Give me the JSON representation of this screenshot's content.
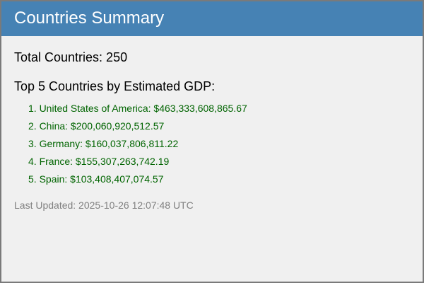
{
  "header": {
    "title": "Countries Summary"
  },
  "summary": {
    "total_label": "Total Countries: 250",
    "top_heading": "Top 5 Countries by Estimated GDP:",
    "countries": [
      {
        "text": "1. United States of America: $463,333,608,865.67"
      },
      {
        "text": "2. China: $200,060,920,512.57"
      },
      {
        "text": "3. Germany: $160,037,806,811.22"
      },
      {
        "text": "4. France: $155,307,263,742.19"
      },
      {
        "text": "5. Spain: $103,408,407,074.57"
      }
    ],
    "last_updated": "Last Updated: 2025-10-26 12:07:48 UTC"
  },
  "colors": {
    "header_bg": "#4682b4",
    "list_text": "#006400",
    "muted_text": "#808080",
    "page_bg": "#f0f0f0"
  }
}
